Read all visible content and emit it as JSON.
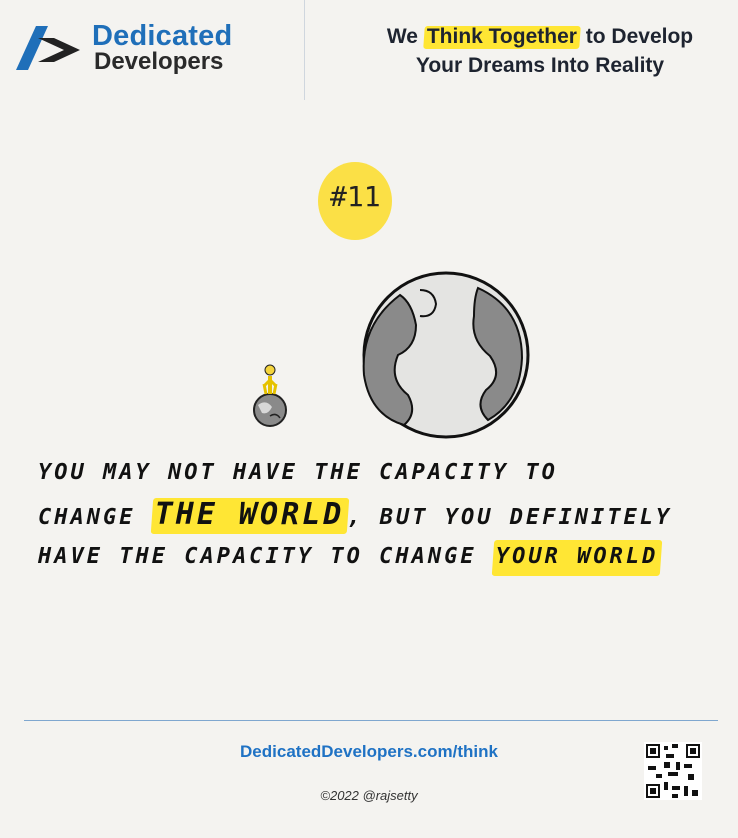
{
  "brand": {
    "name_line1": "Dedicated",
    "name_line2": "Developers"
  },
  "tagline": {
    "part1": "We ",
    "highlight": "Think Together",
    "part2": " to Develop",
    "line2": "Your Dreams Into Reality"
  },
  "badge": {
    "label": "#11"
  },
  "quote": {
    "line1": "YOU MAY NOT HAVE THE CAPACITY TO",
    "line2_pre": "CHANGE ",
    "line2_highlight": "THE WORLD",
    "line2_post": ", BUT YOU DEFINITELY",
    "line3_pre": "HAVE THE CAPACITY TO CHANGE ",
    "line3_highlight": "YOUR WORLD"
  },
  "footer": {
    "link": "DedicatedDevelopers.com/think",
    "copyright": "©2022 @rajsetty"
  },
  "colors": {
    "brand_blue": "#1f6fb9",
    "highlight_yellow": "#ffe634",
    "text_dark": "#1e2430"
  },
  "icons": [
    "logo-mark-icon",
    "person-on-globe-icon",
    "large-globe-icon",
    "qr-code-icon"
  ]
}
